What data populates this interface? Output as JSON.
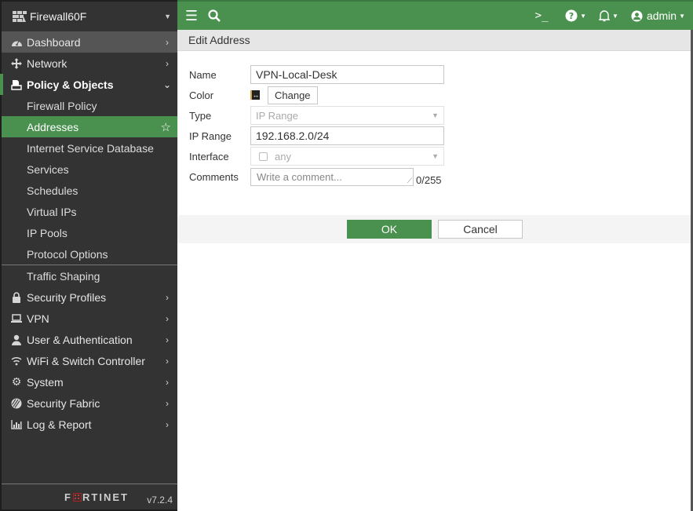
{
  "sidebar": {
    "device_name": "Firewall60F",
    "items": [
      {
        "label": "Dashboard",
        "icon": "dashboard-gauge-icon",
        "state": "hover"
      },
      {
        "label": "Network",
        "icon": "network-arrows-icon"
      },
      {
        "label": "Policy & Objects",
        "icon": "policy-objects-icon",
        "state": "open"
      },
      {
        "label": "Security Profiles",
        "icon": "lock-icon"
      },
      {
        "label": "VPN",
        "icon": "laptop-icon"
      },
      {
        "label": "User & Authentication",
        "icon": "user-icon"
      },
      {
        "label": "WiFi & Switch Controller",
        "icon": "wifi-icon"
      },
      {
        "label": "System",
        "icon": "gear-icon"
      },
      {
        "label": "Security Fabric",
        "icon": "security-fabric-icon"
      },
      {
        "label": "Log & Report",
        "icon": "bar-chart-icon"
      }
    ],
    "sub_items": [
      {
        "label": "Firewall Policy"
      },
      {
        "label": "Addresses",
        "active": true
      },
      {
        "label": "Internet Service Database"
      },
      {
        "label": "Services"
      },
      {
        "label": "Schedules"
      },
      {
        "label": "Virtual IPs"
      },
      {
        "label": "IP Pools"
      },
      {
        "label": "Protocol Options"
      },
      {
        "label": "Traffic Shaping"
      }
    ],
    "brand": "FORTINET",
    "version": "v7.2.4"
  },
  "topbar": {
    "cli_symbol": ">_",
    "user": "admin"
  },
  "page": {
    "title": "Edit Address",
    "form": {
      "name_label": "Name",
      "name_value": "VPN-Local-Desk",
      "color_label": "Color",
      "color_change": "Change",
      "type_label": "Type",
      "type_value": "IP Range",
      "iprange_label": "IP Range",
      "iprange_value": "192.168.2.0/24",
      "interface_label": "Interface",
      "interface_value": "any",
      "comments_label": "Comments",
      "comments_placeholder": "Write a comment...",
      "comments_count": "0/255"
    },
    "ok_label": "OK",
    "cancel_label": "Cancel"
  },
  "colors": {
    "accent": "#4a9150",
    "sidebar_bg": "#333333",
    "sidebar_hover": "#555555"
  }
}
